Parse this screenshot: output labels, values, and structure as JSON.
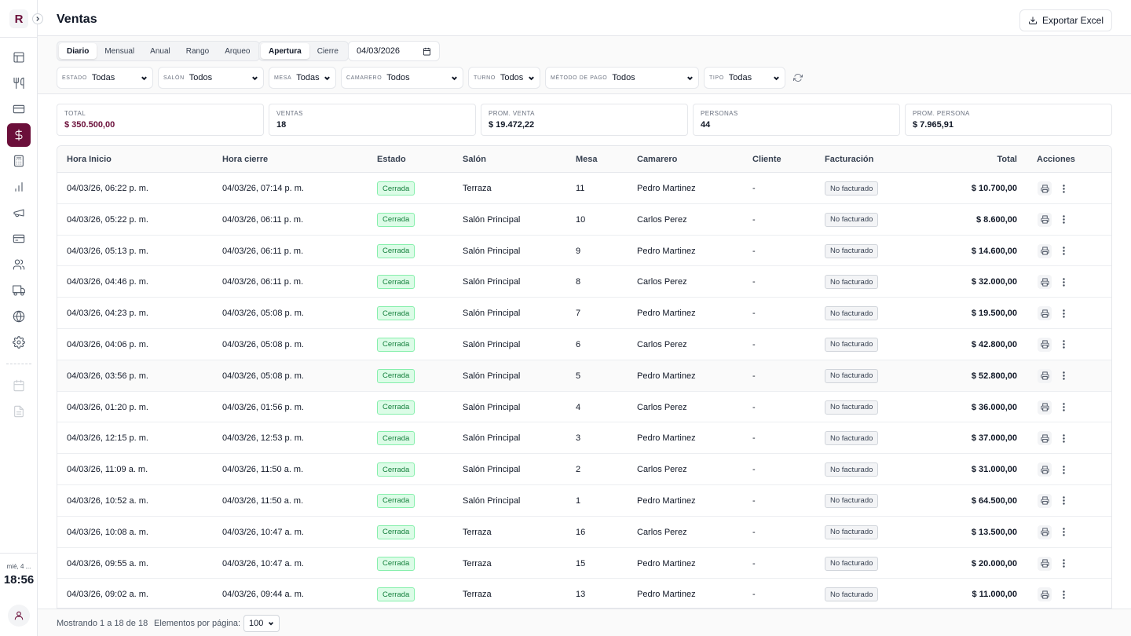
{
  "sidebar": {
    "logo": "R",
    "clock_date": "mié, 4 ...",
    "clock_time": "18:56"
  },
  "header": {
    "title": "Ventas",
    "export_label": "Exportar Excel"
  },
  "period_tabs": [
    "Diario",
    "Mensual",
    "Anual",
    "Rango",
    "Arqueo"
  ],
  "period_selected": "Diario",
  "mode_tabs": [
    "Apertura",
    "Cierre"
  ],
  "mode_selected": "Apertura",
  "date_value": "04/03/2026",
  "filters": {
    "estado": {
      "label": "Estado",
      "value": "Todas"
    },
    "salon": {
      "label": "Salón",
      "value": "Todos"
    },
    "mesa": {
      "label": "Mesa",
      "value": "Todas"
    },
    "camarero": {
      "label": "Camarero",
      "value": "Todos"
    },
    "turno": {
      "label": "Turno",
      "value": "Todos"
    },
    "metodo": {
      "label": "Método de pago",
      "value": "Todos"
    },
    "tipo": {
      "label": "Tipo",
      "value": "Todas"
    }
  },
  "stats": {
    "total": {
      "label": "Total",
      "value": "$ 350.500,00"
    },
    "ventas": {
      "label": "Ventas",
      "value": "18"
    },
    "prom_venta": {
      "label": "Prom. venta",
      "value": "$ 19.472,22"
    },
    "personas": {
      "label": "Personas",
      "value": "44"
    },
    "prom_persona": {
      "label": "Prom. persona",
      "value": "$ 7.965,91"
    }
  },
  "table": {
    "headers": [
      "Hora Inicio",
      "Hora cierre",
      "Estado",
      "Salón",
      "Mesa",
      "Camarero",
      "Cliente",
      "Facturación",
      "Total",
      "Acciones"
    ],
    "rows": [
      {
        "inicio": "04/03/26, 06:22 p. m.",
        "cierre": "04/03/26, 07:14 p. m.",
        "estado": "Cerrada",
        "salon": "Terraza",
        "mesa": "11",
        "camarero": "Pedro Martinez",
        "cliente": "-",
        "facturacion": "No facturado",
        "total": "$ 10.700,00"
      },
      {
        "inicio": "04/03/26, 05:22 p. m.",
        "cierre": "04/03/26, 06:11 p. m.",
        "estado": "Cerrada",
        "salon": "Salón Principal",
        "mesa": "10",
        "camarero": "Carlos Perez",
        "cliente": "-",
        "facturacion": "No facturado",
        "total": "$ 8.600,00"
      },
      {
        "inicio": "04/03/26, 05:13 p. m.",
        "cierre": "04/03/26, 06:11 p. m.",
        "estado": "Cerrada",
        "salon": "Salón Principal",
        "mesa": "9",
        "camarero": "Pedro Martinez",
        "cliente": "-",
        "facturacion": "No facturado",
        "total": "$ 14.600,00"
      },
      {
        "inicio": "04/03/26, 04:46 p. m.",
        "cierre": "04/03/26, 06:11 p. m.",
        "estado": "Cerrada",
        "salon": "Salón Principal",
        "mesa": "8",
        "camarero": "Carlos Perez",
        "cliente": "-",
        "facturacion": "No facturado",
        "total": "$ 32.000,00"
      },
      {
        "inicio": "04/03/26, 04:23 p. m.",
        "cierre": "04/03/26, 05:08 p. m.",
        "estado": "Cerrada",
        "salon": "Salón Principal",
        "mesa": "7",
        "camarero": "Pedro Martinez",
        "cliente": "-",
        "facturacion": "No facturado",
        "total": "$ 19.500,00"
      },
      {
        "inicio": "04/03/26, 04:06 p. m.",
        "cierre": "04/03/26, 05:08 p. m.",
        "estado": "Cerrada",
        "salon": "Salón Principal",
        "mesa": "6",
        "camarero": "Carlos Perez",
        "cliente": "-",
        "facturacion": "No facturado",
        "total": "$ 42.800,00"
      },
      {
        "inicio": "04/03/26, 03:56 p. m.",
        "cierre": "04/03/26, 05:08 p. m.",
        "estado": "Cerrada",
        "salon": "Salón Principal",
        "mesa": "5",
        "camarero": "Pedro Martinez",
        "cliente": "-",
        "facturacion": "No facturado",
        "total": "$ 52.800,00"
      },
      {
        "inicio": "04/03/26, 01:20 p. m.",
        "cierre": "04/03/26, 01:56 p. m.",
        "estado": "Cerrada",
        "salon": "Salón Principal",
        "mesa": "4",
        "camarero": "Carlos Perez",
        "cliente": "-",
        "facturacion": "No facturado",
        "total": "$ 36.000,00"
      },
      {
        "inicio": "04/03/26, 12:15 p. m.",
        "cierre": "04/03/26, 12:53 p. m.",
        "estado": "Cerrada",
        "salon": "Salón Principal",
        "mesa": "3",
        "camarero": "Pedro Martinez",
        "cliente": "-",
        "facturacion": "No facturado",
        "total": "$ 37.000,00"
      },
      {
        "inicio": "04/03/26, 11:09 a. m.",
        "cierre": "04/03/26, 11:50 a. m.",
        "estado": "Cerrada",
        "salon": "Salón Principal",
        "mesa": "2",
        "camarero": "Carlos Perez",
        "cliente": "-",
        "facturacion": "No facturado",
        "total": "$ 31.000,00"
      },
      {
        "inicio": "04/03/26, 10:52 a. m.",
        "cierre": "04/03/26, 11:50 a. m.",
        "estado": "Cerrada",
        "salon": "Salón Principal",
        "mesa": "1",
        "camarero": "Pedro Martinez",
        "cliente": "-",
        "facturacion": "No facturado",
        "total": "$ 64.500,00"
      },
      {
        "inicio": "04/03/26, 10:08 a. m.",
        "cierre": "04/03/26, 10:47 a. m.",
        "estado": "Cerrada",
        "salon": "Terraza",
        "mesa": "16",
        "camarero": "Carlos Perez",
        "cliente": "-",
        "facturacion": "No facturado",
        "total": "$ 13.500,00"
      },
      {
        "inicio": "04/03/26, 09:55 a. m.",
        "cierre": "04/03/26, 10:47 a. m.",
        "estado": "Cerrada",
        "salon": "Terraza",
        "mesa": "15",
        "camarero": "Pedro Martinez",
        "cliente": "-",
        "facturacion": "No facturado",
        "total": "$ 20.000,00"
      },
      {
        "inicio": "04/03/26, 09:02 a. m.",
        "cierre": "04/03/26, 09:44 a. m.",
        "estado": "Cerrada",
        "salon": "Terraza",
        "mesa": "13",
        "camarero": "Pedro Martinez",
        "cliente": "-",
        "facturacion": "No facturado",
        "total": "$ 11.000,00"
      }
    ]
  },
  "footer": {
    "info": "Mostrando 1 a 18 de 18",
    "per_page_label": "Elementos por página:",
    "per_page_value": "100"
  },
  "colors": {
    "accent": "#6b0f3a",
    "status_ok": "#15803d"
  }
}
